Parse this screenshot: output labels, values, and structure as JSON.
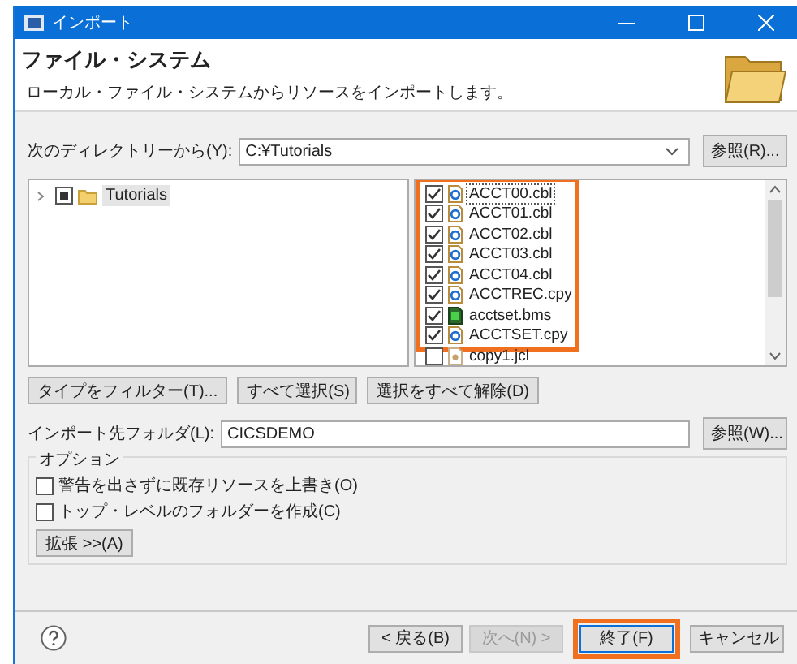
{
  "window": {
    "title": "インポート"
  },
  "header": {
    "title": "ファイル・システム",
    "description": "ローカル・ファイル・システムからリソースをインポートします。"
  },
  "source": {
    "label": "次のディレクトリーから(Y):",
    "value": "C:¥Tutorials",
    "browse": "参照(R)..."
  },
  "folders": [
    {
      "label": "Tutorials",
      "expanded": false,
      "checked": true,
      "grayed": true,
      "selected": true
    }
  ],
  "file_groups": [
    {
      "highlighted": true,
      "files": [
        {
          "name": "ACCT00.cbl",
          "kind": "cobol",
          "checked": true,
          "focused": true
        },
        {
          "name": "ACCT01.cbl",
          "kind": "cobol",
          "checked": true,
          "focused": false
        },
        {
          "name": "ACCT02.cbl",
          "kind": "cobol",
          "checked": true,
          "focused": false
        },
        {
          "name": "ACCT03.cbl",
          "kind": "cobol",
          "checked": true,
          "focused": false
        },
        {
          "name": "ACCT04.cbl",
          "kind": "cobol",
          "checked": true,
          "focused": false
        },
        {
          "name": "ACCTREC.cpy",
          "kind": "cobol",
          "checked": true,
          "focused": false
        },
        {
          "name": "acctset.bms",
          "kind": "bms",
          "checked": true,
          "focused": false
        },
        {
          "name": "ACCTSET.cpy",
          "kind": "cobol",
          "checked": true,
          "focused": false
        }
      ]
    },
    {
      "highlighted": false,
      "files": [
        {
          "name": "copy1.jcl",
          "kind": "jcl",
          "checked": false,
          "focused": false
        }
      ]
    }
  ],
  "selection_buttons": [
    "タイプをフィルター(T)...",
    "すべて選択(S)",
    "選択をすべて解除(D)"
  ],
  "target": {
    "label": "インポート先フォルダ(L):",
    "value": "CICSDEMO",
    "browse": "参照(W)..."
  },
  "options": {
    "title": "オプション",
    "checkboxes": [
      {
        "label": "警告を出さずに既存リソースを上書き(O)",
        "checked": false
      },
      {
        "label": "トップ・レベルのフォルダーを作成(C)",
        "checked": false
      }
    ],
    "advanced": "拡張 >>(A)"
  },
  "footer_buttons": [
    {
      "label": "< 戻る(B)",
      "disabled": false,
      "highlighted": false
    },
    {
      "label": "次へ(N) >",
      "disabled": true,
      "highlighted": false
    },
    {
      "label": "終了(F)",
      "disabled": false,
      "highlighted": true
    },
    {
      "label": "キャンセル",
      "disabled": false,
      "highlighted": false
    }
  ]
}
